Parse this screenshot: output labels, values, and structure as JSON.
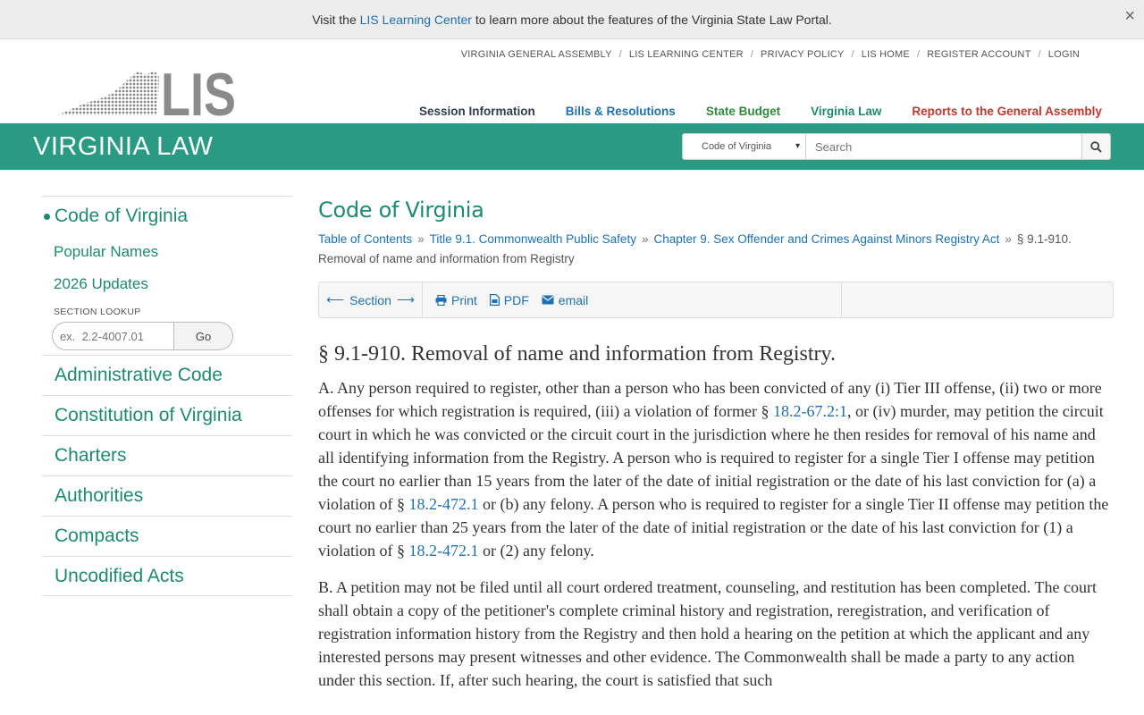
{
  "announcement": {
    "prefix": "Visit the ",
    "link": "LIS Learning Center",
    "suffix": " to learn more about the features of the Virginia State Law Portal.",
    "close": "×"
  },
  "top_links": [
    "VIRGINIA GENERAL ASSEMBLY",
    "LIS LEARNING CENTER",
    "PRIVACY POLICY",
    "LIS HOME",
    "REGISTER ACCOUNT",
    "LOGIN"
  ],
  "separator": "/",
  "logo": {
    "text": "LIS"
  },
  "main_nav": [
    {
      "label": "Session Information",
      "color": "#2d3e50"
    },
    {
      "label": "Bills & Resolutions",
      "color": "#1f6fb2"
    },
    {
      "label": "State Budget",
      "color": "#2e8b3a"
    },
    {
      "label": "Virginia Law",
      "color": "#1f8a71"
    },
    {
      "label": "Reports to the General Assembly",
      "color": "#c0392b"
    }
  ],
  "banner": {
    "title": "VIRGINIA LAW",
    "select_value": "Code of Virginia",
    "search_placeholder": "Search"
  },
  "sidebar": {
    "current": "Code of Virginia",
    "sub_items": [
      "Popular Names",
      "2026 Updates"
    ],
    "lookup_label": "SECTION LOOKUP",
    "lookup_placeholder": "ex.  2.2-4007.01",
    "go_label": "Go",
    "items": [
      "Administrative Code",
      "Constitution of Virginia",
      "Charters",
      "Authorities",
      "Compacts",
      "Uncodified Acts"
    ]
  },
  "content": {
    "heading": "Code of Virginia",
    "breadcrumbs": {
      "links": [
        "Table of Contents",
        "Title 9.1. Commonwealth Public Safety",
        "Chapter 9. Sex Offender and Crimes Against Minors Registry Act"
      ],
      "current": "§ 9.1-910. Removal of name and information from Registry",
      "sep": "»"
    },
    "toolbar": {
      "section_label": "Section",
      "print": "Print",
      "pdf": "PDF",
      "email": "email"
    },
    "section_title": "§ 9.1-910. Removal of name and information from Registry.",
    "para_a": {
      "t1": "A. Any person required to register, other than a person who has been convicted of any (i) Tier III offense, (ii) two or more offenses for which registration is required, (iii) a violation of former § ",
      "l1": "18.2-67.2:1",
      "t2": ", or (iv) murder, may petition the circuit court in which he was convicted or the circuit court in the jurisdiction where he then resides for removal of his name and all identifying information from the Registry. A person who is required to register for a single Tier I offense may petition the court no earlier than 15 years from the later of the date of initial registration or the date of his last conviction for (a) a violation of § ",
      "l2": "18.2-472.1",
      "t3": " or (b) any felony. A person who is required to register for a single Tier II offense may petition the court no earlier than 25 years from the later of the date of initial registration or the date of his last conviction for (1) a violation of § ",
      "l3": "18.2-472.1",
      "t4": " or (2) any felony."
    },
    "para_b": "B. A petition may not be filed until all court ordered treatment, counseling, and restitution has been completed. The court shall obtain a copy of the petitioner's complete criminal history and registration, reregistration, and verification of registration information history from the Registry and then hold a hearing on the petition at which the applicant and any interested persons may present witnesses and other evidence. The Commonwealth shall be made a party to any action under this section. If, after such hearing, the court is satisfied that such"
  },
  "colors": {
    "teal": "#2a9b82",
    "link": "#1f6fb2",
    "green_text": "#1f8a71"
  }
}
